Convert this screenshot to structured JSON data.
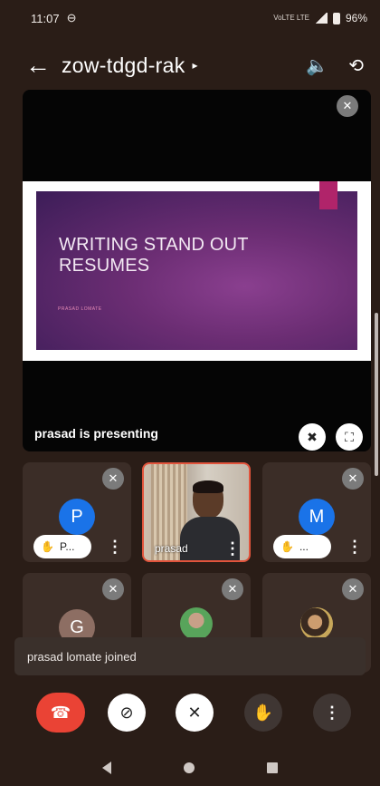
{
  "status_bar": {
    "time": "11:07",
    "network": "VoLTE LTE",
    "battery": "96%"
  },
  "header": {
    "back_icon": "arrow-left",
    "meeting_code": "zow-tdgd-rak",
    "caret": "▸",
    "speaker_icon": "speaker",
    "switch_camera_icon": "camera-switch"
  },
  "presentation": {
    "slide_title": "WRITING STAND OUT\nRESUMES",
    "slide_author": "PRASAD LOMATE",
    "presenting_label": "prasad is presenting",
    "slide_accent_color": "#b0246a"
  },
  "participants": [
    {
      "initial": "P",
      "avatar_color": "#1a73e8",
      "chip_label": "P...",
      "muted": true
    },
    {
      "name": "prasad",
      "video": true,
      "muted": false
    },
    {
      "initial": "M",
      "avatar_color": "#1a73e8",
      "chip_label": "...",
      "muted": true
    },
    {
      "initial": "G",
      "avatar_color": "#8d6e63",
      "muted": true
    },
    {
      "photo": true,
      "muted": true
    },
    {
      "photo": true,
      "muted": true
    }
  ],
  "toast": {
    "message": "prasad lomate joined"
  },
  "controls": {
    "end_call_color": "#ea4335"
  }
}
